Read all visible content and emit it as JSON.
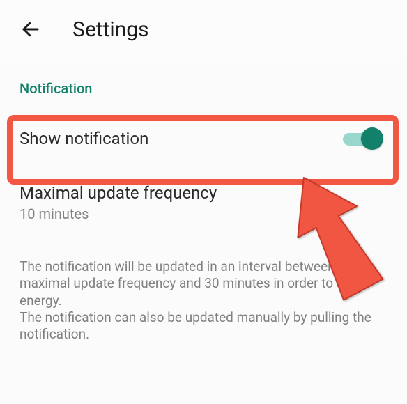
{
  "header": {
    "title": "Settings"
  },
  "section": {
    "label": "Notification"
  },
  "show_notification": {
    "label": "Show notification",
    "enabled": true
  },
  "update_frequency": {
    "title": "Maximal update frequency",
    "value": "10 minutes"
  },
  "helper": "The notification will be updated in an interval between the maximal update frequency and 30 minutes in order to save energy.\nThe notification can also be updated manually by pulling the notification.",
  "colors": {
    "accent": "#13806a",
    "highlight": "#f15743"
  }
}
